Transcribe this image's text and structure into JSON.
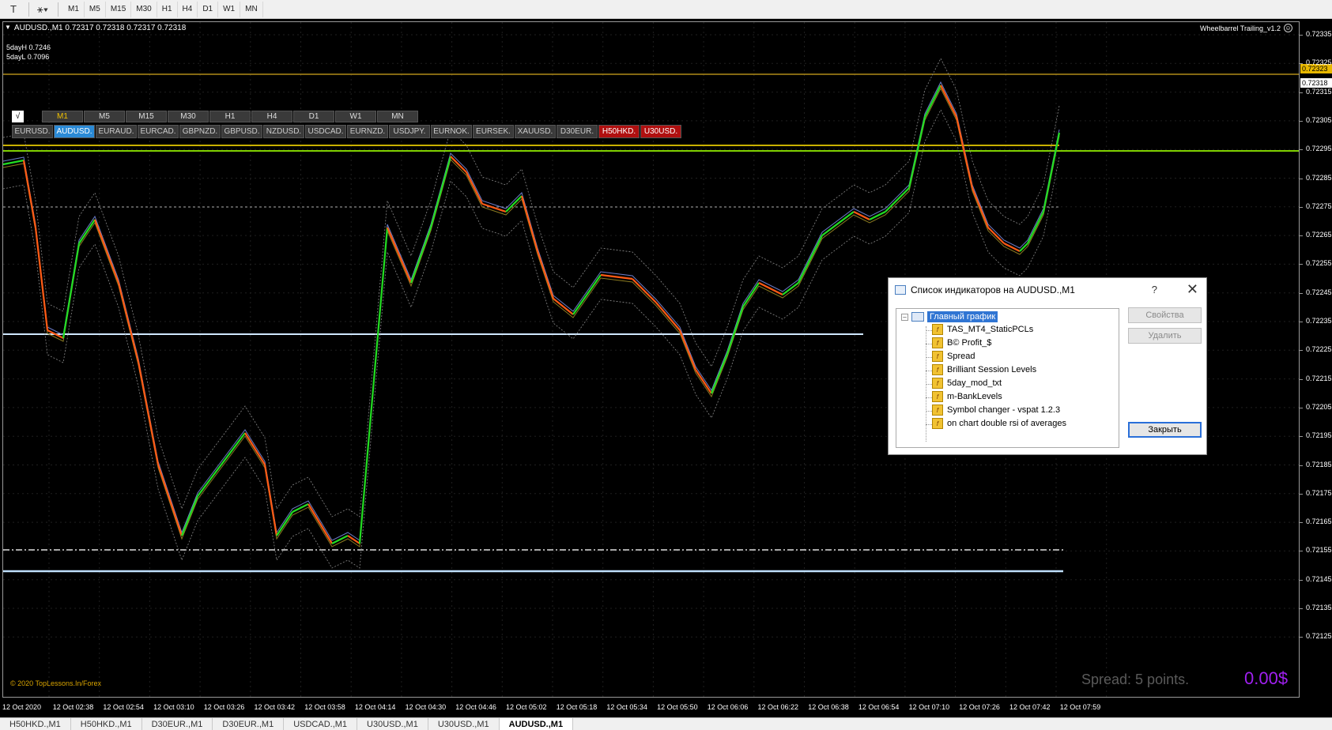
{
  "toolbar": {
    "icons": [
      "text-icon",
      "objects-icon"
    ],
    "timeframes": [
      "M1",
      "M5",
      "M15",
      "M30",
      "H1",
      "H4",
      "D1",
      "W1",
      "MN"
    ]
  },
  "chart": {
    "symbol_line": "AUDUSD.,M1  0.72317 0.72318 0.72317 0.72318",
    "info_high": "5dayH 0.7246",
    "info_low": "5dayL 0.7096",
    "ea_name": "Wheelbarrel Trailing_v1.2",
    "copyright": "© 2020 TopLessons.In/Forex",
    "spread": "Spread: 5 points.",
    "profit": "0.00$"
  },
  "panel": {
    "check": "√",
    "timeframes": [
      "M1",
      "M5",
      "M15",
      "M30",
      "H1",
      "H4",
      "D1",
      "W1",
      "MN"
    ],
    "active_tf": 0,
    "symbols": [
      "EURUSD.",
      "AUDUSD.",
      "EURAUD.",
      "EURCAD.",
      "GBPNZD.",
      "GBPUSD.",
      "NZDUSD.",
      "USDCAD.",
      "EURNZD.",
      "USDJPY.",
      "EURNOK.",
      "EURSEK.",
      "XAUUSD.",
      "D30EUR.",
      "H50HKD.",
      "U30USD."
    ],
    "active_symbol": 1,
    "red_symbols": [
      14,
      15
    ]
  },
  "price_axis": {
    "labels": [
      "0.72335",
      "0.72325",
      "0.72315",
      "0.72305",
      "0.72295",
      "0.72285",
      "0.72275",
      "0.72265",
      "0.72255",
      "0.72245",
      "0.72235",
      "0.72225",
      "0.72215",
      "0.72205",
      "0.72195",
      "0.72185",
      "0.72175",
      "0.72165",
      "0.72155",
      "0.72145",
      "0.72135",
      "0.72125"
    ],
    "tag_yellow": "0.72323",
    "tag_white": "0.72318"
  },
  "time_axis": {
    "labels": [
      "12 Oct 2020",
      "12 Oct 02:38",
      "12 Oct 02:54",
      "12 Oct 03:10",
      "12 Oct 03:26",
      "12 Oct 03:42",
      "12 Oct 03:58",
      "12 Oct 04:14",
      "12 Oct 04:30",
      "12 Oct 04:46",
      "12 Oct 05:02",
      "12 Oct 05:18",
      "12 Oct 05:34",
      "12 Oct 05:50",
      "12 Oct 06:06",
      "12 Oct 06:22",
      "12 Oct 06:38",
      "12 Oct 06:54",
      "12 Oct 07:10",
      "12 Oct 07:26",
      "12 Oct 07:42",
      "12 Oct 07:59"
    ]
  },
  "dialog": {
    "title": "Список индикаторов на AUDUSD.,M1",
    "help": "?",
    "close": "✕",
    "root": "Главный график",
    "items": [
      "TAS_MT4_StaticPCLs",
      "B© Profit_$",
      "Spread",
      "Brilliant Session Levels",
      "5day_mod_txt",
      "m-BankLevels",
      "Symbol changer - vspat 1.2.3",
      "on chart double rsi of averages"
    ],
    "btn_properties": "Свойства",
    "btn_delete": "Удалить",
    "btn_close": "Закрыть"
  },
  "tabs": {
    "items": [
      "H50HKD.,M1",
      "H50HKD.,M1",
      "D30EUR.,M1",
      "D30EUR.,M1",
      "USDCAD.,M1",
      "U30USD.,M1",
      "U30USD.,M1",
      "AUDUSD.,M1"
    ],
    "active": 7
  }
}
